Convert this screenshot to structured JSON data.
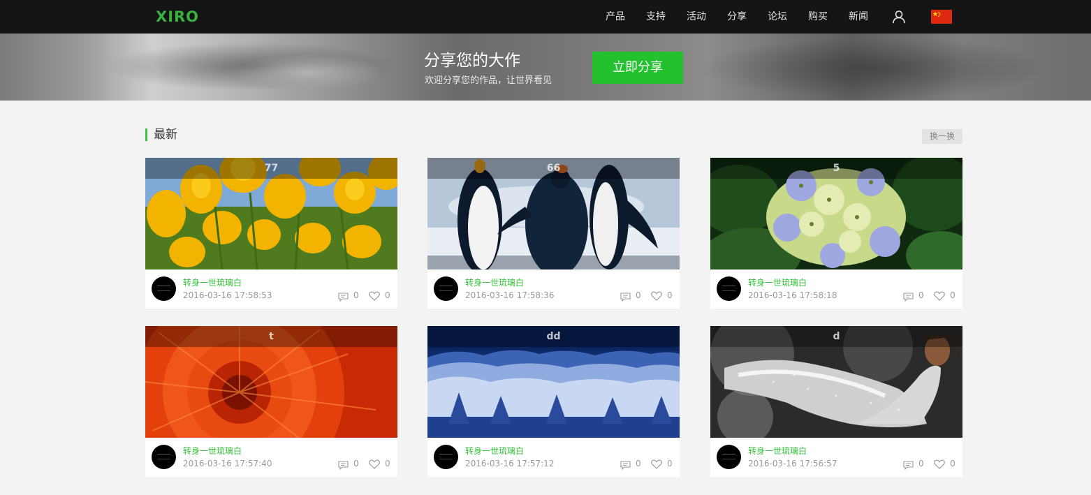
{
  "header": {
    "logo": "XIRO",
    "nav": [
      "产品",
      "支持",
      "活动",
      "分享",
      "论坛",
      "购买",
      "新闻"
    ]
  },
  "banner": {
    "title": "分享您的大作",
    "subtitle": "欢迎分享您的作品，让世界看见",
    "button": "立即分享"
  },
  "section": {
    "title": "最新",
    "refresh": "换一换"
  },
  "cards": [
    {
      "title": "77",
      "author": "转身一世琉璃白",
      "time": "2016-03-16 17:58:53",
      "comments": "0",
      "likes": "0",
      "image": "yellow-tulips"
    },
    {
      "title": "66",
      "author": "转身一世琉璃白",
      "time": "2016-03-16 17:58:36",
      "comments": "0",
      "likes": "0",
      "image": "penguins"
    },
    {
      "title": "5",
      "author": "转身一世琉璃白",
      "time": "2016-03-16 17:58:18",
      "comments": "0",
      "likes": "0",
      "image": "hydrangea"
    },
    {
      "title": "t",
      "author": "转身一世琉璃白",
      "time": "2016-03-16 17:57:40",
      "comments": "0",
      "likes": "0",
      "image": "red-chrysanthemum"
    },
    {
      "title": "dd",
      "author": "转身一世琉璃白",
      "time": "2016-03-16 17:57:12",
      "comments": "0",
      "likes": "0",
      "image": "snowy-forest"
    },
    {
      "title": "d",
      "author": "转身一世琉璃白",
      "time": "2016-03-16 17:56:57",
      "comments": "0",
      "likes": "0",
      "image": "woman-sequins"
    }
  ],
  "colors": {
    "accent": "#24c12f",
    "nav_bg": "#141414",
    "author": "#35c03b"
  }
}
